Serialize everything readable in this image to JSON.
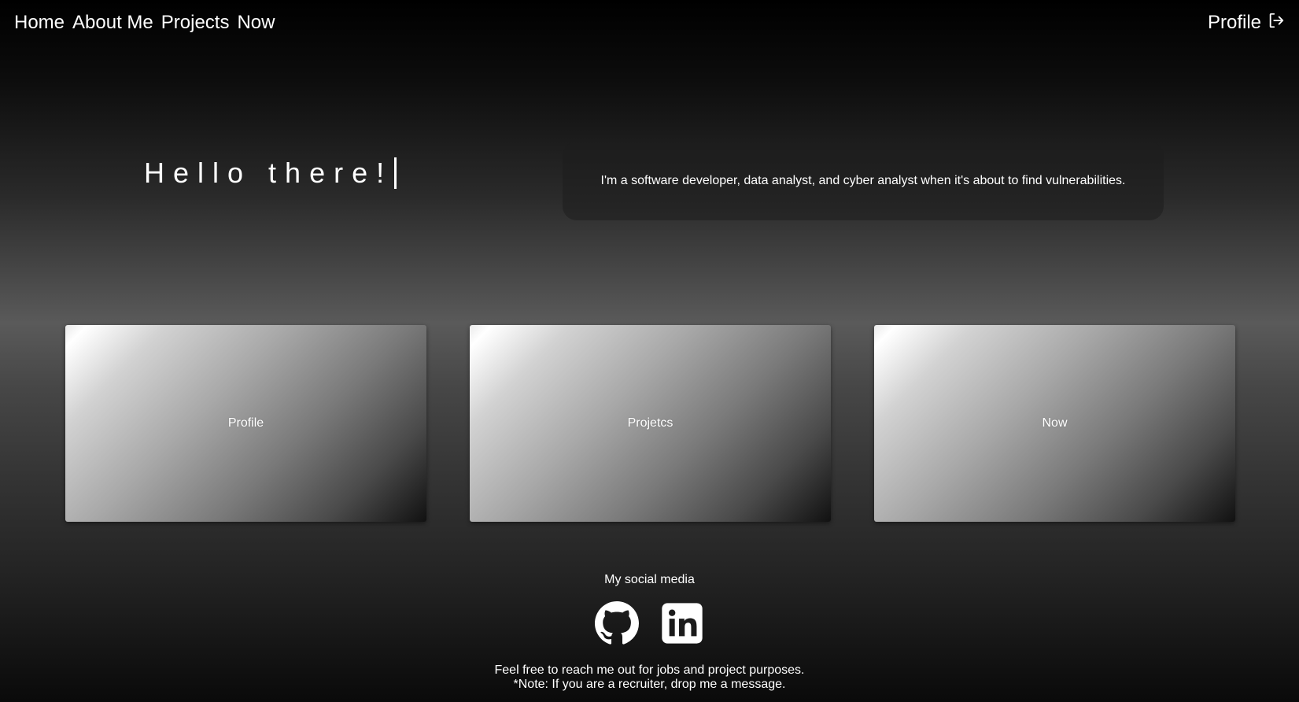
{
  "nav": {
    "links": [
      {
        "label": "Home"
      },
      {
        "label": "About Me"
      },
      {
        "label": "Projects"
      },
      {
        "label": "Now"
      }
    ],
    "profile_label": "Profile",
    "profile_icon": "logout-icon"
  },
  "hero": {
    "title": "Hello there!",
    "intro": "I'm a software developer, data analyst, and cyber analyst when it's about to find vulnerabilities."
  },
  "cards": [
    {
      "label": "Profile"
    },
    {
      "label": "Projetcs"
    },
    {
      "label": "Now"
    }
  ],
  "footer": {
    "social_title": "My social media",
    "social_icons": [
      "github-icon",
      "linkedin-icon"
    ],
    "line1": "Feel free to reach me out for jobs and project purposes.",
    "line2": "*Note: If you are a recruiter, drop me a message."
  }
}
